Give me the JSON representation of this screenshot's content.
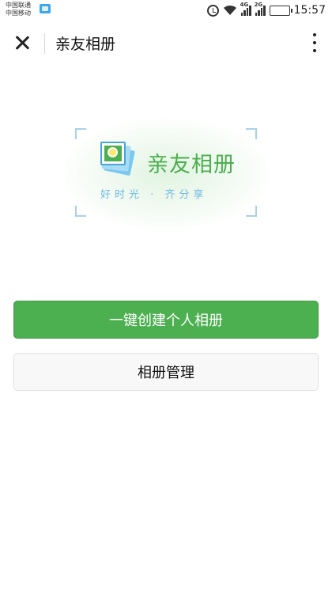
{
  "status_bar": {
    "carrier_1": "中国联通",
    "carrier_2": "中国移动",
    "signal_1_label": "4G",
    "signal_2_label": "2G",
    "time": "15:57",
    "icons": [
      "notification-icon",
      "alarm-icon",
      "wifi-icon",
      "signal-icon",
      "battery-charging-icon"
    ],
    "battery_color": "#5fbf3f"
  },
  "nav": {
    "title": "亲友相册",
    "close_icon": "close-icon",
    "more_icon": "more-vertical-icon"
  },
  "logo": {
    "title": "亲友相册",
    "slogan": "好时光 · 齐分享",
    "icon": "photo-album-icon",
    "title_color": "#4cae4f",
    "slogan_color": "#6cb9e6"
  },
  "actions": {
    "create_label": "一键创建个人相册",
    "manage_label": "相册管理",
    "primary_color": "#4caf50"
  }
}
